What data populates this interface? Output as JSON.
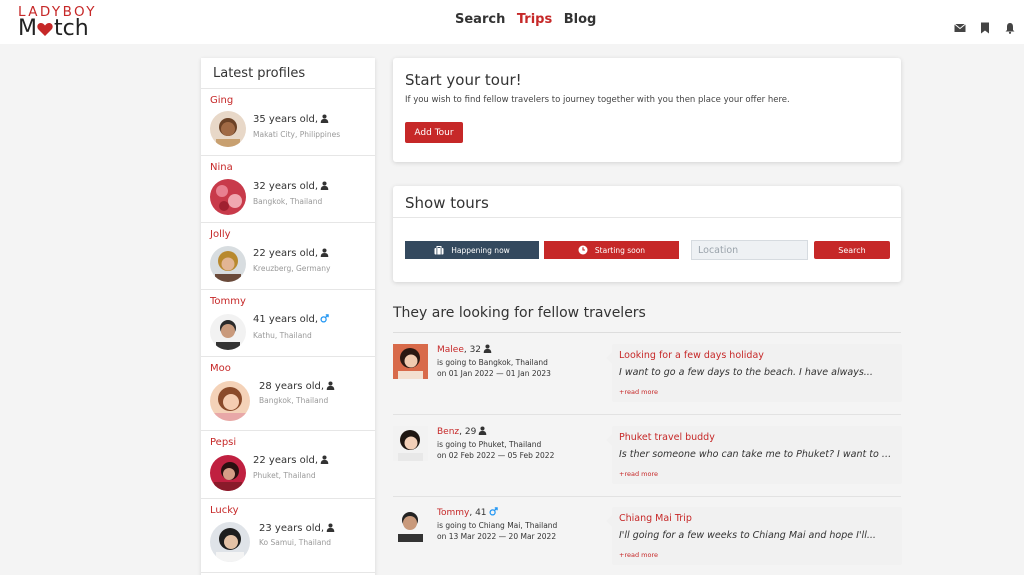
{
  "header": {
    "logo_top": "LADYBOY",
    "logo_m": "M",
    "logo_rest": "tch",
    "nav": [
      "Search",
      "Trips",
      "Blog"
    ],
    "active_nav": "Trips",
    "icons": [
      "envelope-icon",
      "bookmark-icon",
      "bell-icon"
    ]
  },
  "latest": {
    "title": "Latest profiles",
    "profiles": [
      {
        "name": "Ging",
        "age": "35 years old,",
        "location": "Makati City, Philippines",
        "gender_icon": "person-icon"
      },
      {
        "name": "Nina",
        "age": "32 years old,",
        "location": "Bangkok, Thailand",
        "gender_icon": "person-icon"
      },
      {
        "name": "Jolly",
        "age": "22 years old,",
        "location": "Kreuzberg, Germany",
        "gender_icon": "person-icon"
      },
      {
        "name": "Tommy",
        "age": "41 years old,",
        "location": "Kathu, Thailand",
        "gender_icon": "male-icon"
      },
      {
        "name": "Moo",
        "age": "28 years old,",
        "location": "Bangkok, Thailand",
        "gender_icon": "person-icon"
      },
      {
        "name": "Pepsi",
        "age": "22 years old,",
        "location": "Phuket, Thailand",
        "gender_icon": "person-icon"
      },
      {
        "name": "Lucky",
        "age": "23 years old,",
        "location": "Ko Samui, Thailand",
        "gender_icon": "person-icon"
      }
    ]
  },
  "tour": {
    "title": "Start your tour!",
    "subtitle": "If you wish to find fellow travelers to journey together with you then place your offer here.",
    "add_label": "Add Tour"
  },
  "show": {
    "title": "Show tours",
    "happening_label": "Happening now",
    "soon_label": "Starting soon",
    "location_placeholder": "Location",
    "search_label": "Search"
  },
  "looking": {
    "title": "They are looking for fellow travelers",
    "travelers": [
      {
        "name": "Malee",
        "age": ", 32",
        "gender_icon": "person-icon",
        "going": "is going to Bangkok, Thailand",
        "dates": "on 01 Jan 2022 — 01 Jan 2023",
        "tour_title": "Looking for a few days holiday",
        "tour_text": "I want to go a few days to the beach. I have always...",
        "more": "+read more"
      },
      {
        "name": "Benz",
        "age": ", 29",
        "gender_icon": "person-icon",
        "going": "is going to Phuket, Thailand",
        "dates": "on 02 Feb 2022 — 05 Feb 2022",
        "tour_title": "Phuket travel buddy",
        "tour_text": "Is ther someone who can take me to Phuket? I want to go there",
        "more": "+read more"
      },
      {
        "name": "Tommy",
        "age": ", 41",
        "gender_icon": "male-icon",
        "going": "is going to Chiang Mai, Thailand",
        "dates": "on 13 Mar 2022 — 20 Mar 2022",
        "tour_title": "Chiang Mai Trip",
        "tour_text": "I'll going for a few weeks to Chiang Mai and hope I'll...",
        "more": "+read more"
      }
    ]
  },
  "colors": {
    "brand": "#c62828",
    "dark_button": "#34495e",
    "male_icon": "#2196f3"
  }
}
